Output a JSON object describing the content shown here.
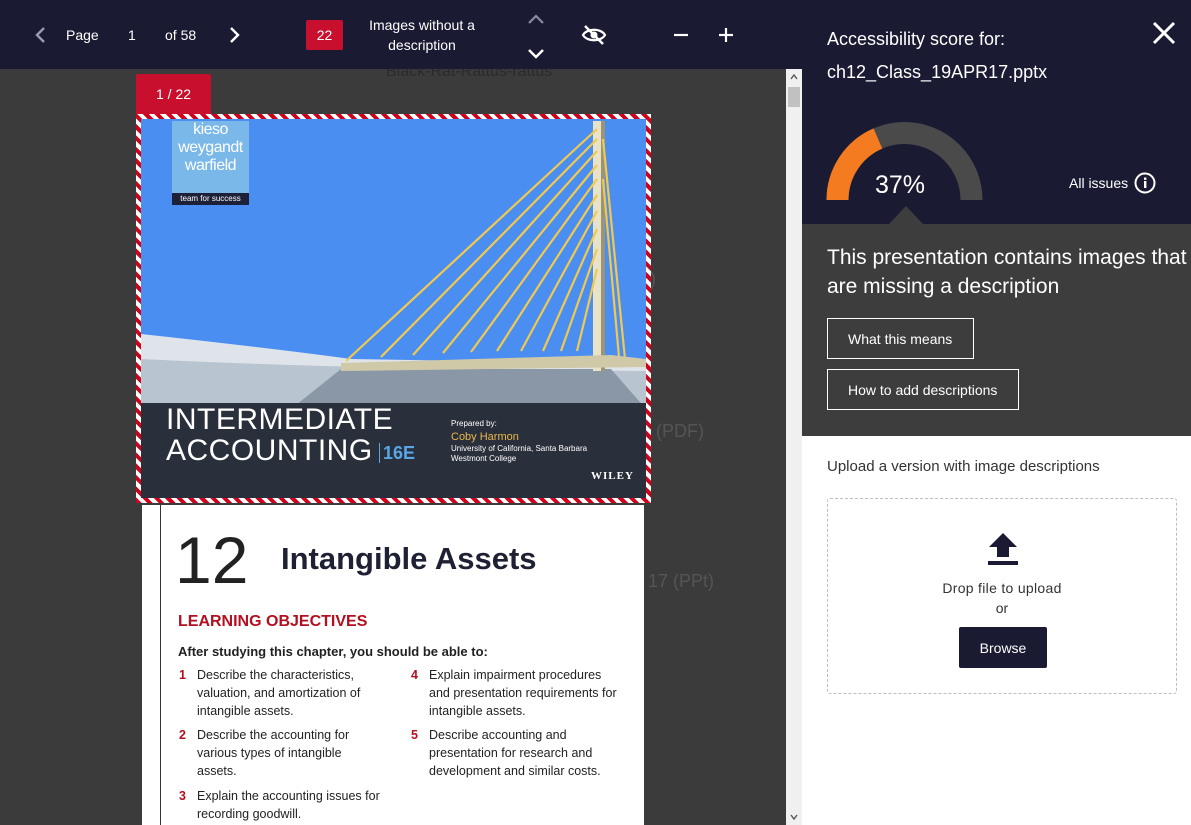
{
  "toolbar": {
    "page_label": "Page",
    "page_current": "1",
    "page_of": "of 58",
    "issue_count": "22",
    "filter_label": "Images without a description",
    "icons": [
      "chevron-left-icon",
      "chevron-right-icon",
      "chevron-up-icon",
      "chevron-down-icon",
      "eye-off-icon",
      "minus-icon",
      "plus-icon"
    ]
  },
  "viewer": {
    "background_texts": [
      "Black-Rat-Rattus-rattus",
      ")",
      "(PDF)",
      "17 (PPt)"
    ],
    "image_marker": "1 / 22",
    "cover": {
      "logo_lines": [
        "kieso",
        "weygandt",
        "warfield"
      ],
      "logo_tagline": "team for success",
      "title_line1": "INTERMEDIATE",
      "title_line2": "ACCOUNTING",
      "edition": "16E",
      "prepared_by": "Prepared by:",
      "author": "Coby Harmon",
      "affiliation1": "University of California, Santa Barbara",
      "affiliation2": "Westmont College",
      "publisher": "WILEY"
    },
    "chapter": {
      "number": "12",
      "title": "Intangible Assets",
      "objectives_heading": "LEARNING OBJECTIVES",
      "objectives_intro": "After studying this chapter, you should be able to:",
      "objectives": [
        {
          "n": "1",
          "text": "Describe the characteristics, valuation, and amortization of intangible assets."
        },
        {
          "n": "2",
          "text": "Describe the accounting for various types of intangible assets."
        },
        {
          "n": "3",
          "text": "Explain the accounting issues for recording goodwill."
        },
        {
          "n": "4",
          "text": "Explain impairment procedures and presentation requirements for intangible assets."
        },
        {
          "n": "5",
          "text": "Describe accounting and presentation for research and development and similar costs."
        }
      ]
    }
  },
  "panel": {
    "score_label": "Accessibility score for:",
    "file_name": "ch12_Class_19APR17.pptx",
    "score_value": 37,
    "score_text": "37%",
    "all_issues": "All issues",
    "issue_message": "This presentation contains images that are missing a description",
    "what_this_means": "What this means",
    "how_to_add": "How to add descriptions",
    "upload_label": "Upload a version with image descriptions",
    "drop_text": "Drop file to upload",
    "or_text": "or",
    "browse": "Browse"
  },
  "colors": {
    "toolbar_bg": "#1a1b33",
    "accent_red": "#c8102e",
    "gauge_fill": "#f47b20",
    "gauge_track": "#4a4a4a",
    "panel_mid_bg": "#3d3d3d"
  }
}
